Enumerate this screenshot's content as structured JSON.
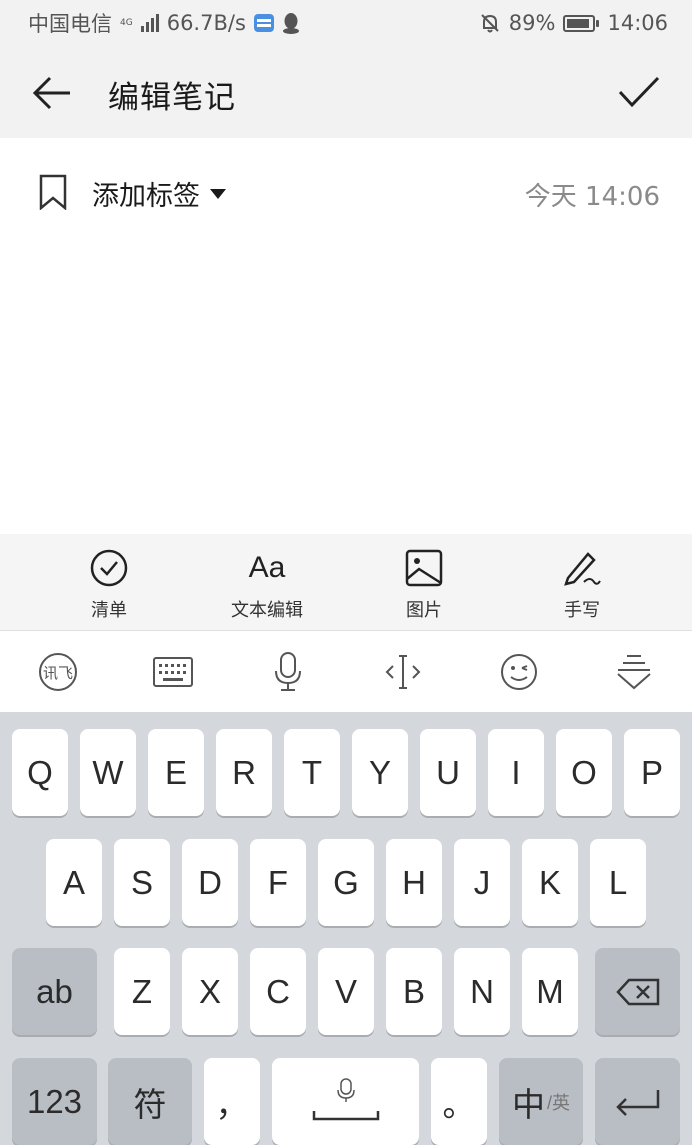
{
  "status_bar": {
    "carrier": "中国电信",
    "network": "4G",
    "speed": "66.7B/s",
    "battery": "89%",
    "battery_level": 0.89,
    "time": "14:06"
  },
  "header": {
    "title": "编辑笔记"
  },
  "note": {
    "tag_label": "添加标签",
    "time": "今天 14:06"
  },
  "format_toolbar": {
    "items": [
      {
        "label": "清单",
        "icon": "checklist-icon"
      },
      {
        "label": "文本编辑",
        "icon": "text-format-icon",
        "glyph": "Aa"
      },
      {
        "label": "图片",
        "icon": "image-icon"
      },
      {
        "label": "手写",
        "icon": "handwriting-icon"
      }
    ]
  },
  "ime_toolbar": {
    "icons": [
      "ifly-logo-icon",
      "keyboard-icon",
      "microphone-icon",
      "cursor-move-icon",
      "emoji-icon",
      "hide-keyboard-icon"
    ],
    "logo_text": "讯飞"
  },
  "keyboard": {
    "row1": [
      "Q",
      "W",
      "E",
      "R",
      "T",
      "Y",
      "U",
      "I",
      "O",
      "P"
    ],
    "row2": [
      "A",
      "S",
      "D",
      "F",
      "G",
      "H",
      "J",
      "K",
      "L"
    ],
    "row3": [
      "Z",
      "X",
      "C",
      "V",
      "B",
      "N",
      "M"
    ],
    "shift_label": "ab",
    "numbers_label": "123",
    "symbols_label": "符",
    "comma_label": "，",
    "period_label": "。",
    "lang_main": "中",
    "lang_sub": "/英"
  }
}
